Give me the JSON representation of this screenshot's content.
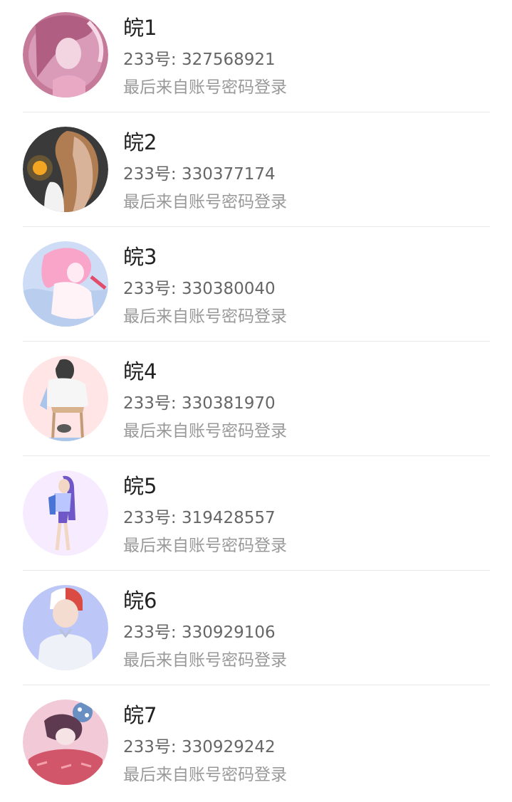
{
  "accounts": [
    {
      "name": "皖1",
      "number_label": "233号: 327568921",
      "login_source": "最后来自账号密码登录",
      "avatar_colors": [
        "#b05f83",
        "#e9a9c5",
        "#f3d5e2"
      ]
    },
    {
      "name": "皖2",
      "number_label": "233号: 330377174",
      "login_source": "最后来自账号密码登录",
      "avatar_colors": [
        "#3a3a3a",
        "#f5a623",
        "#d8b39a"
      ]
    },
    {
      "name": "皖3",
      "number_label": "233号: 330380040",
      "login_source": "最后来自账号密码登录",
      "avatar_colors": [
        "#b9cdef",
        "#f8a5c9",
        "#ffeaf3"
      ]
    },
    {
      "name": "皖4",
      "number_label": "233号: 330381970",
      "login_source": "最后来自账号密码登录",
      "avatar_colors": [
        "#ffe5e5",
        "#5a5a5a",
        "#a9c5ea"
      ]
    },
    {
      "name": "皖5",
      "number_label": "233号: 319428557",
      "login_source": "最后来自账号密码登录",
      "avatar_colors": [
        "#f7ecff",
        "#6f57c7",
        "#f1d7c4"
      ]
    },
    {
      "name": "皖6",
      "number_label": "233号: 330929106",
      "login_source": "最后来自账号密码登录",
      "avatar_colors": [
        "#bcc7f7",
        "#d94b43",
        "#eef2f8"
      ]
    },
    {
      "name": "皖7",
      "number_label": "233号: 330929242",
      "login_source": "最后来自账号密码登录",
      "avatar_colors": [
        "#f1c9d7",
        "#5d3a4f",
        "#d25669"
      ]
    }
  ]
}
